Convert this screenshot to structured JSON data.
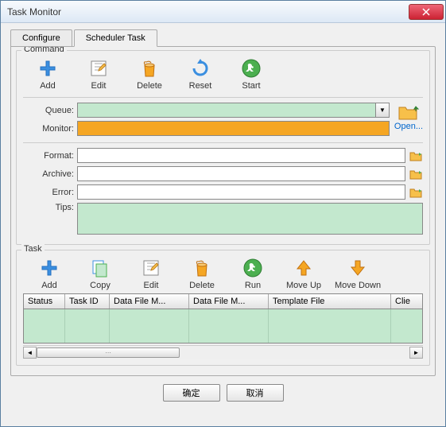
{
  "window": {
    "title": "Task Monitor"
  },
  "tabs": {
    "configure": "Configure",
    "scheduler": "Scheduler Task"
  },
  "command": {
    "legend": "Command",
    "buttons": {
      "add": "Add",
      "edit": "Edit",
      "delete": "Delete",
      "reset": "Reset",
      "start": "Start"
    },
    "fields": {
      "queue_label": "Queue:",
      "queue_value": "",
      "monitor_label": "Monitor:",
      "monitor_value": "",
      "open_label": "Open...",
      "format_label": "Format:",
      "format_value": "",
      "archive_label": "Archive:",
      "archive_value": "",
      "error_label": "Error:",
      "error_value": "",
      "tips_label": "Tips:",
      "tips_value": ""
    }
  },
  "task": {
    "legend": "Task",
    "buttons": {
      "add": "Add",
      "copy": "Copy",
      "edit": "Edit",
      "delete": "Delete",
      "run": "Run",
      "move_up": "Move Up",
      "move_down": "Move Down"
    },
    "columns": [
      "Status",
      "Task ID",
      "Data File M...",
      "Data File M...",
      "Template File",
      "Clie"
    ],
    "rows": []
  },
  "footer": {
    "ok": "确定",
    "cancel": "取消"
  }
}
